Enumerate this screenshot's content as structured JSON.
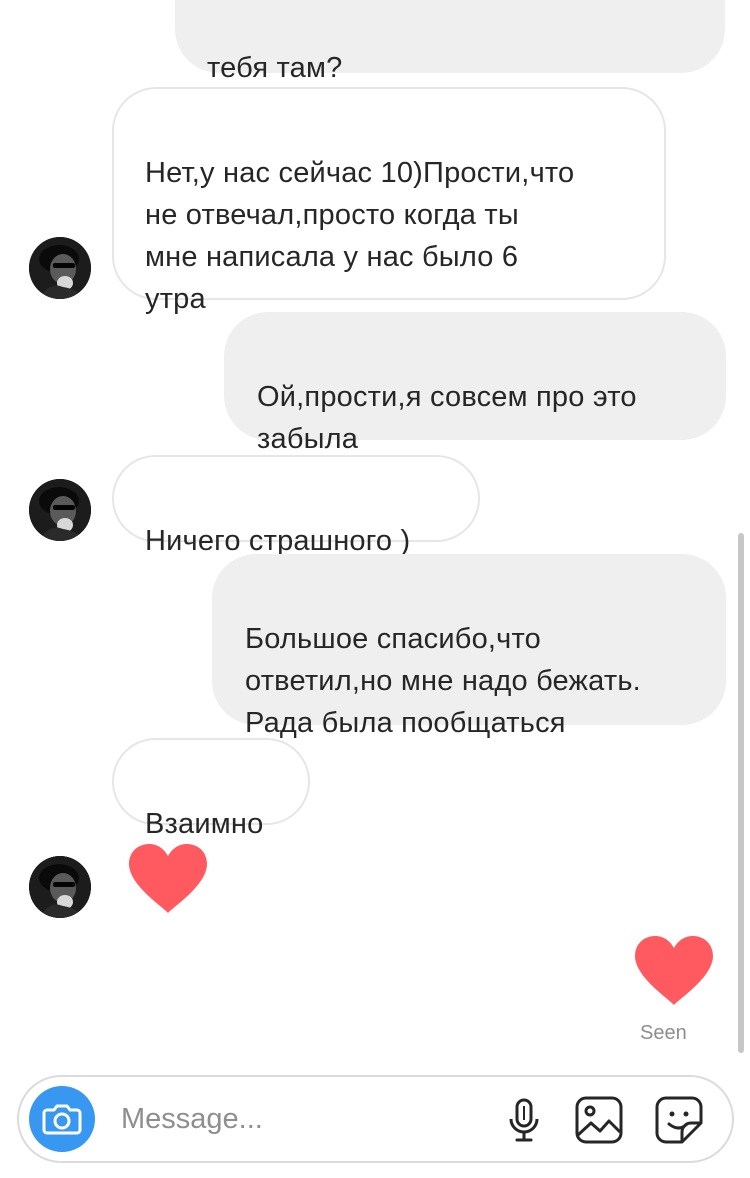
{
  "thread": {
    "messages": [
      {
        "id": "m1",
        "direction": "outgoing",
        "text": "тебя там?"
      },
      {
        "id": "m2",
        "direction": "incoming",
        "text": "Нет,у нас сейчас 10)Прости,что\nне отвечал,просто когда ты\nмне написала у нас было 6\nутра"
      },
      {
        "id": "m3",
        "direction": "outgoing",
        "text": "Ой,прости,я совсем про это\nзабыла"
      },
      {
        "id": "m4",
        "direction": "incoming",
        "text": "Ничего страшного )"
      },
      {
        "id": "m5",
        "direction": "outgoing",
        "text": "Большое спасибо,что\nответил,но мне надо бежать.\nРада была пообщаться"
      },
      {
        "id": "m6",
        "direction": "incoming",
        "text": "Взаимно"
      },
      {
        "id": "m7",
        "direction": "incoming",
        "type": "heart"
      },
      {
        "id": "m8",
        "direction": "outgoing",
        "type": "heart"
      }
    ],
    "seen_label": "Seen",
    "heart_color": "#ff5a5f",
    "incoming_bubble_color": "#ffffff",
    "outgoing_bubble_color": "#efefef"
  },
  "composer": {
    "placeholder": "Message...",
    "camera_color": "#3897f0",
    "icons": [
      "camera-icon",
      "microphone-icon",
      "gallery-icon",
      "sticker-icon"
    ]
  }
}
